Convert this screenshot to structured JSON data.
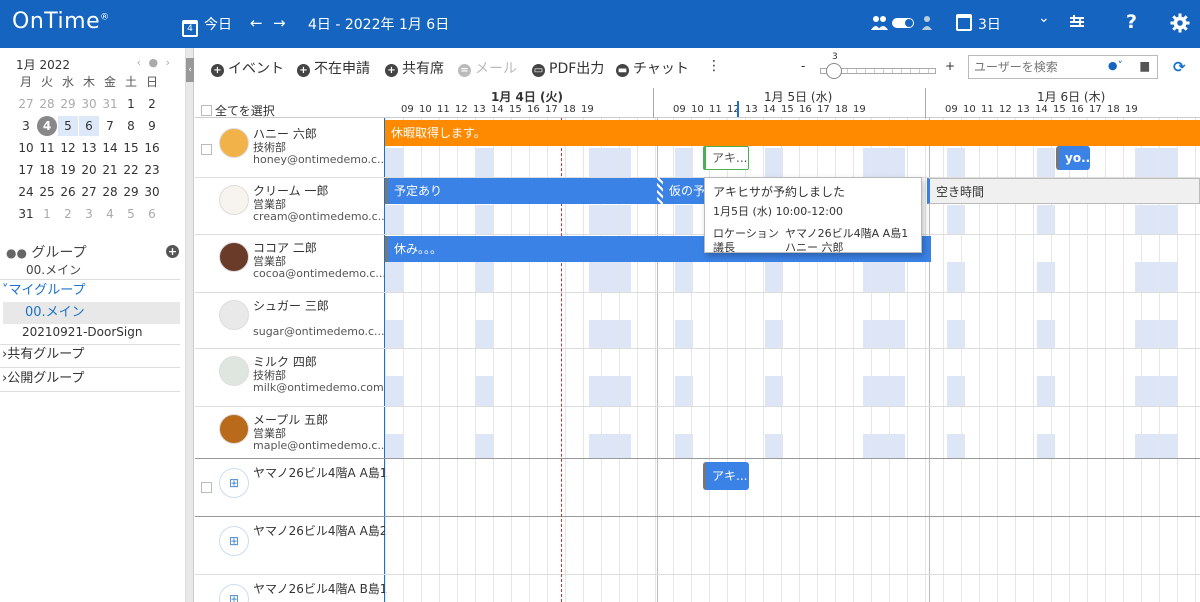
{
  "app": {
    "logo": "OnTime",
    "logo_reg": "®"
  },
  "header": {
    "today_icon_num": "4",
    "today_label": "今日",
    "prev_arrow": "←",
    "next_arrow": "→",
    "date_range": "4日 - 2022年 1月 6日",
    "view_days": "3日",
    "view_chevron": "⌄",
    "help": "?",
    "settings_icon": "gear-icon"
  },
  "mini_calendar": {
    "month": "1月 2022",
    "nav": "‹ ● ›",
    "weekdays": [
      "月",
      "火",
      "水",
      "木",
      "金",
      "土",
      "日"
    ],
    "weeks": [
      [
        "27",
        "28",
        "29",
        "30",
        "31",
        "1",
        "2"
      ],
      [
        "3",
        "4",
        "5",
        "6",
        "7",
        "8",
        "9"
      ],
      [
        "10",
        "11",
        "12",
        "13",
        "14",
        "15",
        "16"
      ],
      [
        "17",
        "18",
        "19",
        "20",
        "21",
        "22",
        "23"
      ],
      [
        "24",
        "25",
        "26",
        "27",
        "28",
        "29",
        "30"
      ],
      [
        "31",
        "1",
        "2",
        "3",
        "4",
        "5",
        "6"
      ]
    ],
    "today": "4"
  },
  "groups": {
    "header": "グループ",
    "current": "00.メイン",
    "my_group": "マイグループ",
    "items": [
      "00.メイン",
      "20210921-DoorSign"
    ],
    "shared": "共有グループ",
    "public": "公開グループ"
  },
  "toolbar": {
    "event": "イベント",
    "absence": "不在申請",
    "shared_seat": "共有席",
    "mail": "メール",
    "pdf": "PDF出力",
    "chat": "チャット",
    "more": "⋮",
    "zoom_minus": "-",
    "zoom_value": "3",
    "zoom_plus": "+",
    "search_placeholder": "ユーザーを検索"
  },
  "timeline": {
    "select_all": "全てを選択",
    "days": [
      "1月 4日 (火)",
      "1月 5日 (水)",
      "1月 6日 (木)"
    ],
    "hours": [
      "09",
      "10",
      "11",
      "12",
      "13",
      "14",
      "15",
      "16",
      "17",
      "18",
      "19"
    ]
  },
  "people": [
    {
      "name": "ハニー 六郎",
      "dept": "技術部",
      "email": "honey@ontimedemo.c..."
    },
    {
      "name": "クリーム 一郎",
      "dept": "営業部",
      "email": "cream@ontimedemo.c..."
    },
    {
      "name": "ココア 二郎",
      "dept": "営業部",
      "email": "cocoa@ontimedemo.c..."
    },
    {
      "name": "シュガー 三郎",
      "dept": "",
      "email": "sugar@ontimedemo.c..."
    },
    {
      "name": "ミルク 四郎",
      "dept": "技術部",
      "email": "milk@ontimedemo.com"
    },
    {
      "name": "メープル 五郎",
      "dept": "営業部",
      "email": "maple@ontimedemo.c..."
    },
    {
      "name": "ヤマノ26ビル4階A A島1",
      "dept": "",
      "email": ""
    },
    {
      "name": "ヤマノ26ビル4階A A島2",
      "dept": "",
      "email": ""
    },
    {
      "name": "ヤマノ26ビル4階A B島1",
      "dept": "",
      "email": ""
    }
  ],
  "events": {
    "vacation": "休暇取得します。",
    "aki1": "アキ...",
    "yo": "yo...",
    "planned": "予定あり",
    "tentative": "仮の予定",
    "free": "空き時間",
    "rest": "休み。。。",
    "aki2": "アキ..."
  },
  "popup": {
    "title": "アキヒサが予約しました",
    "datetime": "1月5日 (水) 10:00-12:00",
    "location_label": "ロケーション",
    "location_value": "ヤマノ26ビル4階A A島1",
    "chair_label": "議長",
    "chair_value": "ハニー 六郎"
  },
  "colors": {
    "header": "#1565c0",
    "vacation": "#ff8a00",
    "event_blue": "#3b82e6",
    "link_blue": "#1a73c9",
    "shade": "#dde6f7"
  }
}
